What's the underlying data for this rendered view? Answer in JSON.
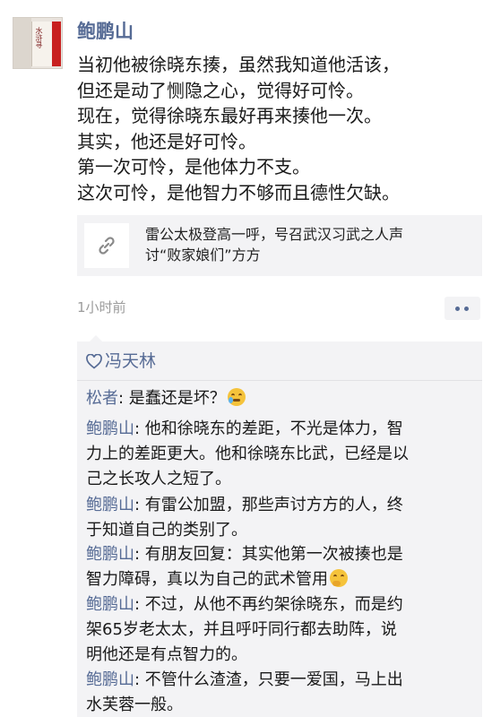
{
  "post": {
    "author": "鲍鹏山",
    "avatar_book_title": "水浒寻",
    "lines": [
      "当初他被徐晓东揍，虽然我知道他活该，",
      "但还是动了恻隐之心，觉得好可怜。",
      "现在，觉得徐晓东最好再来揍他一次。",
      "其实，他还是好可怜。",
      "第一次可怜，是他体力不支。",
      "这次可怜，是他智力不够而且德性欠缺。"
    ],
    "link_card": {
      "icon": "link-icon",
      "line1": "雷公太极登高一呼，号召武汉习武之人声",
      "line2": "讨“败家娘们”方方"
    },
    "time": "1小时前",
    "more_icon": "more-dots-icon"
  },
  "likes": {
    "icon": "heart-icon",
    "names": "冯天林"
  },
  "comments": [
    {
      "name": "松者",
      "sep": ": ",
      "lines": [
        "是蠢还是坏？"
      ],
      "emoji": "sweat-smile-emoji"
    },
    {
      "name": "鲍鹏山",
      "sep": ": ",
      "lines": [
        "他和徐晓东的差距，不光是体力，智",
        "力上的差距更大。他和徐晓东比武，已经是以",
        "己之长攻人之短了。"
      ]
    },
    {
      "name": "鲍鹏山",
      "sep": ": ",
      "lines": [
        "有雷公加盟，那些声讨方方的人，终",
        "于知道自己的类别了。"
      ]
    },
    {
      "name": "鲍鹏山",
      "sep": ": ",
      "lines": [
        "有朋友回复：其实他第一次被揍也是",
        "智力障碍，真以为自己的武术管用"
      ],
      "emoji": "thinking-emoji"
    },
    {
      "name": "鲍鹏山",
      "sep": ": ",
      "lines": [
        "不过，从他不再约架徐晓东，而是约",
        "架65岁老太太，并且呼吁同行都去助阵，说",
        "明他还是有点智力的。"
      ]
    },
    {
      "name": "鲍鹏山",
      "sep": ": ",
      "lines": [
        "不管什么渣渣，只要一爱国，马上出",
        "水芙蓉一般。"
      ]
    }
  ]
}
